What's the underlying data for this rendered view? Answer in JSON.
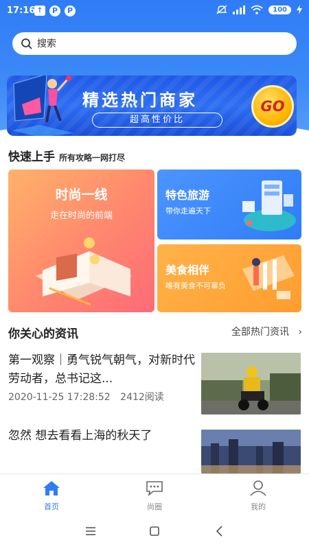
{
  "status_bar": {
    "time": "17:16",
    "left_icons": [
      "upload-icon",
      "p-icon",
      "p-icon"
    ],
    "right_icons": [
      "mute-icon",
      "signal-icon",
      "wifi-icon",
      "battery-icon",
      "charging-icon"
    ],
    "battery_level": "100"
  },
  "search": {
    "placeholder": "搜索",
    "icon": "search-icon"
  },
  "banner": {
    "title": "精选热门商家",
    "subtitle": "超高性价比",
    "go_label": "GO"
  },
  "quick_start": {
    "title": "快速上手",
    "subtitle": "所有攻略一网打尽",
    "cards": [
      {
        "title": "时尚一线",
        "subtitle": "走在时尚的前端",
        "color": "#ff8a6d"
      },
      {
        "title": "特色旅游",
        "subtitle": "带你走遍天下",
        "color": "#3d89fa"
      },
      {
        "title": "美食相伴",
        "subtitle": "唯有美食不可辜负",
        "color": "#ffa73c"
      }
    ]
  },
  "news": {
    "title": "你关心的资讯",
    "more_label": "全部热门资讯",
    "items": [
      {
        "title": "第一观察｜勇气锐气朝气，对新时代劳动者，总书记这...",
        "date": "2020-11-25 17:28:52",
        "reads": "2412阅读"
      },
      {
        "title": "忽然 想去看看上海的秋天了",
        "date": "",
        "reads": ""
      }
    ]
  },
  "tabbar": {
    "items": [
      {
        "label": "首页",
        "icon": "home-icon",
        "active": true
      },
      {
        "label": "尚圈",
        "icon": "chat-icon",
        "active": false
      },
      {
        "label": "我的",
        "icon": "user-icon",
        "active": false
      }
    ],
    "active_color": "#2f7cf6"
  },
  "navbar": {
    "buttons": [
      "menu-icon",
      "home-square-icon",
      "back-icon"
    ]
  }
}
